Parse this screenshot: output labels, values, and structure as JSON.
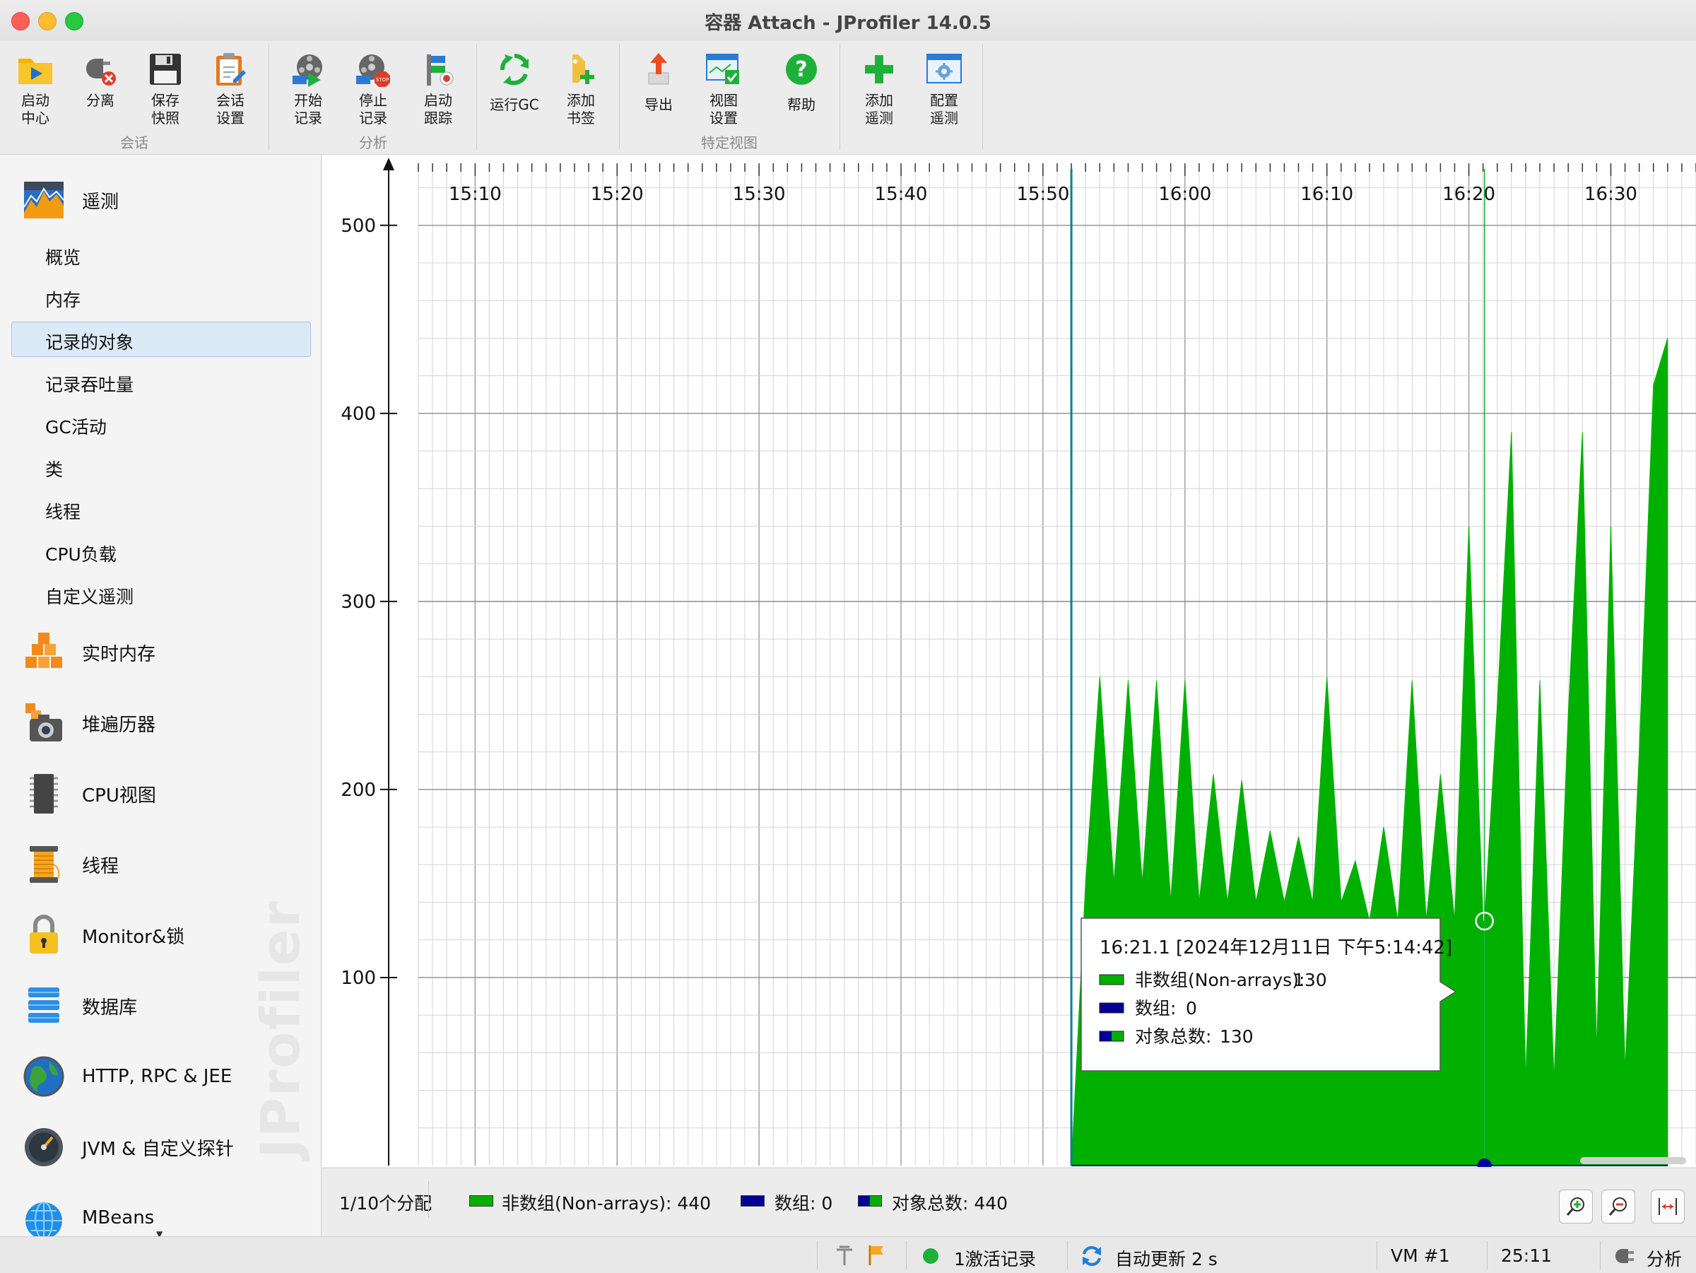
{
  "window": {
    "title": "容器 Attach - JProfiler 14.0.5"
  },
  "toolbar": {
    "groups": [
      {
        "label": "会话",
        "buttons": [
          {
            "label": "启动\n中心",
            "icon": "folder-play-icon"
          },
          {
            "label": "分离",
            "icon": "plug-disconnect-icon"
          },
          {
            "label": "保存\n快照",
            "icon": "floppy-disk-icon"
          },
          {
            "label": "会话\n设置",
            "icon": "clipboard-edit-icon"
          }
        ]
      },
      {
        "label": "分析",
        "buttons": [
          {
            "label": "开始\n记录",
            "icon": "film-reel-play-icon"
          },
          {
            "label": "停止\n记录",
            "icon": "film-reel-stop-icon"
          },
          {
            "label": "启动\n跟踪",
            "icon": "trace-signpost-icon"
          }
        ]
      },
      {
        "label": "",
        "buttons": [
          {
            "label": "运行GC",
            "icon": "gc-recycle-icon"
          },
          {
            "label": "添加\n书签",
            "icon": "bookmark-add-icon"
          }
        ]
      },
      {
        "label": "特定视图",
        "buttons": [
          {
            "label": "导出",
            "icon": "export-arrow-icon"
          },
          {
            "label": "视图\n设置",
            "icon": "view-settings-icon"
          },
          {
            "label": "帮助",
            "icon": "help-icon"
          }
        ]
      },
      {
        "label": "",
        "buttons": [
          {
            "label": "添加\n遥测",
            "icon": "add-plus-icon"
          },
          {
            "label": "配置\n遥测",
            "icon": "configure-telemetry-icon"
          }
        ]
      }
    ]
  },
  "sidebar": {
    "telemetry": {
      "label": "遥测",
      "items": [
        "概览",
        "内存",
        "记录的对象",
        "记录吞吐量",
        "GC活动",
        "类",
        "线程",
        "CPU负载",
        "自定义遥测"
      ],
      "selected": "记录的对象"
    },
    "sections": [
      {
        "label": "实时内存",
        "icon": "live-memory-blocks-icon"
      },
      {
        "label": "堆遍历器",
        "icon": "heap-walker-camera-icon"
      },
      {
        "label": "CPU视图",
        "icon": "cpu-chip-icon"
      },
      {
        "label": "线程",
        "icon": "thread-spool-icon"
      },
      {
        "label": "Monitor&锁",
        "icon": "padlock-icon"
      },
      {
        "label": "数据库",
        "icon": "database-stack-icon"
      },
      {
        "label": "HTTP, RPC & JEE",
        "icon": "globe-icon"
      },
      {
        "label": "JVM & 自定义探针",
        "icon": "gauge-icon"
      },
      {
        "label": "MBeans",
        "icon": "mbeans-globe-icon"
      }
    ],
    "watermark": "JProfiler"
  },
  "chart_data": {
    "type": "area",
    "title": "",
    "xlabel": "",
    "ylabel": "",
    "x_tick_labels": [
      "15:10",
      "15:20",
      "15:30",
      "15:40",
      "15:50",
      "16:00",
      "16:10",
      "16:20",
      "16:30"
    ],
    "y_ticks": [
      100,
      200,
      300,
      400,
      500
    ],
    "ylim": [
      0,
      530
    ],
    "xlim": [
      "15:06",
      "16:36"
    ],
    "grid": true,
    "series": [
      {
        "name": "非数组(Non-arrays)",
        "color": "#00b000",
        "points": [
          [
            "15:52.0",
            0
          ],
          [
            "15:53.0",
            150
          ],
          [
            "15:54.0",
            260
          ],
          [
            "15:55.0",
            150
          ],
          [
            "15:56.0",
            258
          ],
          [
            "15:57.0",
            150
          ],
          [
            "15:58.0",
            258
          ],
          [
            "15:59.0",
            140
          ],
          [
            "16:00.0",
            258
          ],
          [
            "16:01.0",
            140
          ],
          [
            "16:02.0",
            208
          ],
          [
            "16:03.0",
            140
          ],
          [
            "16:04.0",
            205
          ],
          [
            "16:05.0",
            140
          ],
          [
            "16:06.0",
            178
          ],
          [
            "16:07.0",
            140
          ],
          [
            "16:08.0",
            175
          ],
          [
            "16:09.0",
            140
          ],
          [
            "16:10.0",
            260
          ],
          [
            "16:11.0",
            140
          ],
          [
            "16:12.0",
            162
          ],
          [
            "16:13.0",
            130
          ],
          [
            "16:14.0",
            180
          ],
          [
            "16:15.0",
            130
          ],
          [
            "16:16.0",
            258
          ],
          [
            "16:17.0",
            130
          ],
          [
            "16:18.0",
            208
          ],
          [
            "16:19.0",
            130
          ],
          [
            "16:20.0",
            340
          ],
          [
            "16:21.0",
            130
          ],
          [
            "16:21.1",
            130
          ],
          [
            "16:22.0",
            245
          ],
          [
            "16:23.0",
            390
          ],
          [
            "16:24.0",
            45
          ],
          [
            "16:25.0",
            258
          ],
          [
            "16:26.0",
            45
          ],
          [
            "16:27.0",
            240
          ],
          [
            "16:28.0",
            390
          ],
          [
            "16:29.0",
            60
          ],
          [
            "16:30.0",
            340
          ],
          [
            "16:31.0",
            50
          ],
          [
            "16:32.0",
            220
          ],
          [
            "16:33.0",
            415
          ],
          [
            "16:34.0",
            440
          ]
        ]
      },
      {
        "name": "数组",
        "color": "#000099",
        "points": [
          [
            "15:52.0",
            0
          ],
          [
            "16:34.0",
            0
          ]
        ]
      },
      {
        "name": "对象总数",
        "color": "#00b000",
        "points": []
      }
    ],
    "marker_time": "16:21.1",
    "start_time": "15:52.0",
    "tooltip": {
      "header": "16:21.1 [2024年12月11日 下午5:14:42]",
      "rows": [
        {
          "label": "非数组(Non-arrays):",
          "value": "130"
        },
        {
          "label": "数组:",
          "value": "0"
        },
        {
          "label": "对象总数:",
          "value": "130"
        }
      ]
    }
  },
  "legend": {
    "allocation": "1/10个分配",
    "non_arrays": "非数组(Non-arrays): 440",
    "arrays": "数组: 0",
    "total": "对象总数: 440"
  },
  "status": {
    "recording": "1激活记录",
    "auto_update": "自动更新 2 s",
    "vm": "VM #1",
    "elapsed": "25:11",
    "mode": "分析"
  },
  "colors": {
    "series_green": "#00b000",
    "series_blue": "#000099",
    "selection": "#dce9f6"
  }
}
